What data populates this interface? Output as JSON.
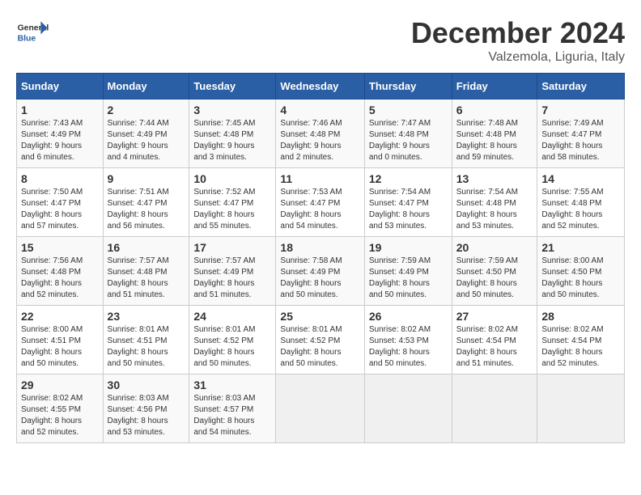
{
  "logo": {
    "general": "General",
    "blue": "Blue"
  },
  "title": "December 2024",
  "subtitle": "Valzemola, Liguria, Italy",
  "days_header": [
    "Sunday",
    "Monday",
    "Tuesday",
    "Wednesday",
    "Thursday",
    "Friday",
    "Saturday"
  ],
  "weeks": [
    [
      {
        "num": "1",
        "rise": "7:43 AM",
        "set": "4:49 PM",
        "daylight": "9 hours and 6 minutes."
      },
      {
        "num": "2",
        "rise": "7:44 AM",
        "set": "4:49 PM",
        "daylight": "9 hours and 4 minutes."
      },
      {
        "num": "3",
        "rise": "7:45 AM",
        "set": "4:48 PM",
        "daylight": "9 hours and 3 minutes."
      },
      {
        "num": "4",
        "rise": "7:46 AM",
        "set": "4:48 PM",
        "daylight": "9 hours and 2 minutes."
      },
      {
        "num": "5",
        "rise": "7:47 AM",
        "set": "4:48 PM",
        "daylight": "9 hours and 0 minutes."
      },
      {
        "num": "6",
        "rise": "7:48 AM",
        "set": "4:48 PM",
        "daylight": "8 hours and 59 minutes."
      },
      {
        "num": "7",
        "rise": "7:49 AM",
        "set": "4:47 PM",
        "daylight": "8 hours and 58 minutes."
      }
    ],
    [
      {
        "num": "8",
        "rise": "7:50 AM",
        "set": "4:47 PM",
        "daylight": "8 hours and 57 minutes."
      },
      {
        "num": "9",
        "rise": "7:51 AM",
        "set": "4:47 PM",
        "daylight": "8 hours and 56 minutes."
      },
      {
        "num": "10",
        "rise": "7:52 AM",
        "set": "4:47 PM",
        "daylight": "8 hours and 55 minutes."
      },
      {
        "num": "11",
        "rise": "7:53 AM",
        "set": "4:47 PM",
        "daylight": "8 hours and 54 minutes."
      },
      {
        "num": "12",
        "rise": "7:54 AM",
        "set": "4:47 PM",
        "daylight": "8 hours and 53 minutes."
      },
      {
        "num": "13",
        "rise": "7:54 AM",
        "set": "4:48 PM",
        "daylight": "8 hours and 53 minutes."
      },
      {
        "num": "14",
        "rise": "7:55 AM",
        "set": "4:48 PM",
        "daylight": "8 hours and 52 minutes."
      }
    ],
    [
      {
        "num": "15",
        "rise": "7:56 AM",
        "set": "4:48 PM",
        "daylight": "8 hours and 52 minutes."
      },
      {
        "num": "16",
        "rise": "7:57 AM",
        "set": "4:48 PM",
        "daylight": "8 hours and 51 minutes."
      },
      {
        "num": "17",
        "rise": "7:57 AM",
        "set": "4:49 PM",
        "daylight": "8 hours and 51 minutes."
      },
      {
        "num": "18",
        "rise": "7:58 AM",
        "set": "4:49 PM",
        "daylight": "8 hours and 50 minutes."
      },
      {
        "num": "19",
        "rise": "7:59 AM",
        "set": "4:49 PM",
        "daylight": "8 hours and 50 minutes."
      },
      {
        "num": "20",
        "rise": "7:59 AM",
        "set": "4:50 PM",
        "daylight": "8 hours and 50 minutes."
      },
      {
        "num": "21",
        "rise": "8:00 AM",
        "set": "4:50 PM",
        "daylight": "8 hours and 50 minutes."
      }
    ],
    [
      {
        "num": "22",
        "rise": "8:00 AM",
        "set": "4:51 PM",
        "daylight": "8 hours and 50 minutes."
      },
      {
        "num": "23",
        "rise": "8:01 AM",
        "set": "4:51 PM",
        "daylight": "8 hours and 50 minutes."
      },
      {
        "num": "24",
        "rise": "8:01 AM",
        "set": "4:52 PM",
        "daylight": "8 hours and 50 minutes."
      },
      {
        "num": "25",
        "rise": "8:01 AM",
        "set": "4:52 PM",
        "daylight": "8 hours and 50 minutes."
      },
      {
        "num": "26",
        "rise": "8:02 AM",
        "set": "4:53 PM",
        "daylight": "8 hours and 50 minutes."
      },
      {
        "num": "27",
        "rise": "8:02 AM",
        "set": "4:54 PM",
        "daylight": "8 hours and 51 minutes."
      },
      {
        "num": "28",
        "rise": "8:02 AM",
        "set": "4:54 PM",
        "daylight": "8 hours and 52 minutes."
      }
    ],
    [
      {
        "num": "29",
        "rise": "8:02 AM",
        "set": "4:55 PM",
        "daylight": "8 hours and 52 minutes."
      },
      {
        "num": "30",
        "rise": "8:03 AM",
        "set": "4:56 PM",
        "daylight": "8 hours and 53 minutes."
      },
      {
        "num": "31",
        "rise": "8:03 AM",
        "set": "4:57 PM",
        "daylight": "8 hours and 54 minutes."
      },
      null,
      null,
      null,
      null
    ]
  ]
}
